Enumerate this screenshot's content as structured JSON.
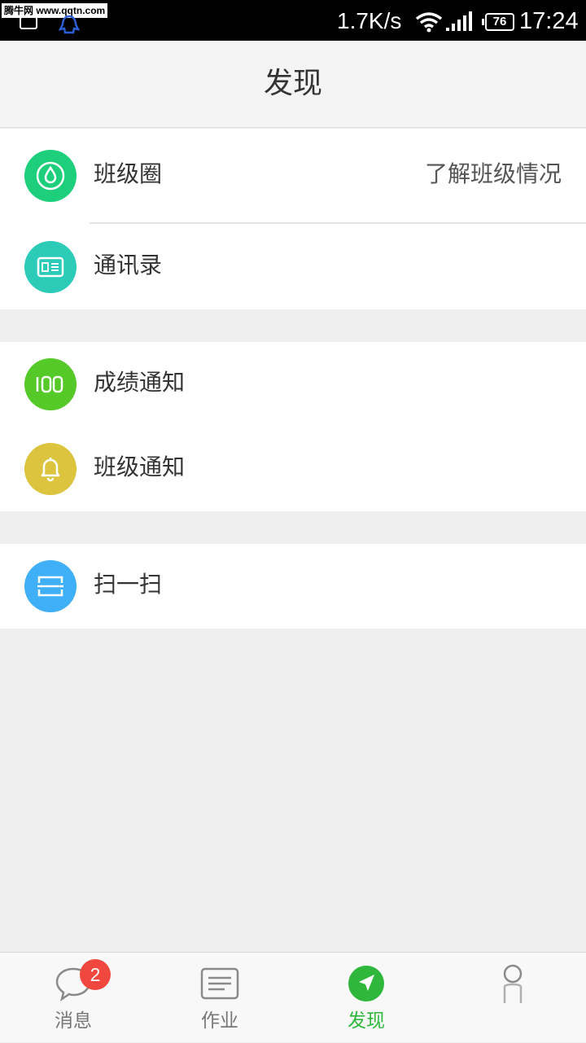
{
  "status_bar": {
    "watermark": "腾牛网 www.qqtn.com",
    "network_speed": "1.7K/s",
    "battery": "76",
    "time": "17:24"
  },
  "header": {
    "title": "发现"
  },
  "groups": [
    {
      "items": [
        {
          "label": "班级圈",
          "aside": "了解班级情况",
          "icon": "droplet-icon",
          "color": "#1dcf7a"
        },
        {
          "label": "通讯录",
          "icon": "contact-card-icon",
          "color": "#2ccbb8"
        }
      ]
    },
    {
      "items": [
        {
          "label": "成绩通知",
          "icon": "score-100-icon",
          "color": "#55c928"
        },
        {
          "label": "班级通知",
          "icon": "bell-icon",
          "color": "#dcc43e"
        }
      ]
    },
    {
      "items": [
        {
          "label": "扫一扫",
          "icon": "scan-icon",
          "color": "#3fb0f7"
        }
      ]
    }
  ],
  "tabbar": {
    "tabs": [
      {
        "label": "消息",
        "icon": "chat-bubble-icon",
        "badge": "2"
      },
      {
        "label": "作业",
        "icon": "homework-list-icon"
      },
      {
        "label": "发现",
        "icon": "discover-compass-icon",
        "active": true
      },
      {
        "label": "",
        "icon": "profile-person-icon"
      }
    ]
  },
  "colors": {
    "active_green": "#2fb73c",
    "badge_red": "#f0473f",
    "background": "#efefef"
  }
}
